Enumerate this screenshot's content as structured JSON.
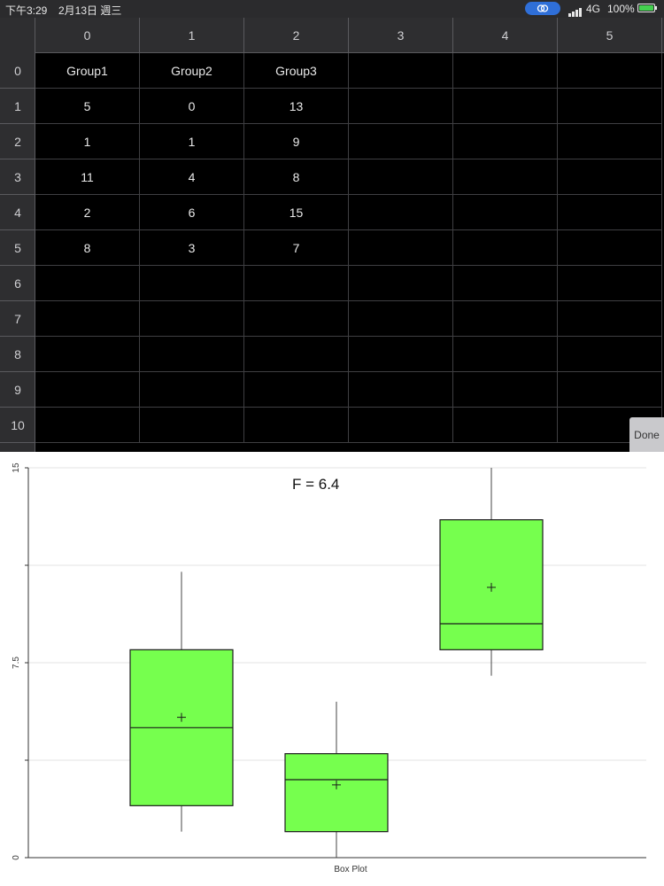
{
  "status_bar": {
    "time": "下午3:29",
    "date": "2月13日 週三",
    "carrier": "4G",
    "battery": "100%"
  },
  "spreadsheet": {
    "column_headers": [
      "0",
      "1",
      "2",
      "3",
      "4",
      "5"
    ],
    "row_headers": [
      "0",
      "1",
      "2",
      "3",
      "4",
      "5",
      "6",
      "7",
      "8",
      "9",
      "10"
    ],
    "rows": [
      [
        "Group1",
        "Group2",
        "Group3",
        "",
        "",
        ""
      ],
      [
        "5",
        "0",
        "13",
        "",
        "",
        ""
      ],
      [
        "1",
        "1",
        "9",
        "",
        "",
        ""
      ],
      [
        "11",
        "4",
        "8",
        "",
        "",
        ""
      ],
      [
        "2",
        "6",
        "15",
        "",
        "",
        ""
      ],
      [
        "8",
        "3",
        "7",
        "",
        "",
        ""
      ],
      [
        "",
        "",
        "",
        "",
        "",
        ""
      ],
      [
        "",
        "",
        "",
        "",
        "",
        ""
      ],
      [
        "",
        "",
        "",
        "",
        "",
        ""
      ],
      [
        "",
        "",
        "",
        "",
        "",
        ""
      ],
      [
        "",
        "",
        "",
        "",
        "",
        ""
      ]
    ],
    "done_label": "Done"
  },
  "chart_data": {
    "type": "box",
    "title": "F = 6.4",
    "xlabel": "Box Plot",
    "ylim": [
      0,
      15
    ],
    "y_tick_labels": [
      "0",
      "7.5",
      "15"
    ],
    "grid": true,
    "box_color": "#76ff4e",
    "series": [
      {
        "name": "Group1",
        "whisker_low": 1,
        "q1": 2,
        "median": 5,
        "q3": 8,
        "whisker_high": 11,
        "mean": 5.4
      },
      {
        "name": "Group2",
        "whisker_low": 0,
        "q1": 1,
        "median": 3,
        "q3": 4,
        "whisker_high": 6,
        "mean": 2.8
      },
      {
        "name": "Group3",
        "whisker_low": 7,
        "q1": 8,
        "median": 9,
        "q3": 13,
        "whisker_high": 15,
        "mean": 10.4
      }
    ]
  }
}
